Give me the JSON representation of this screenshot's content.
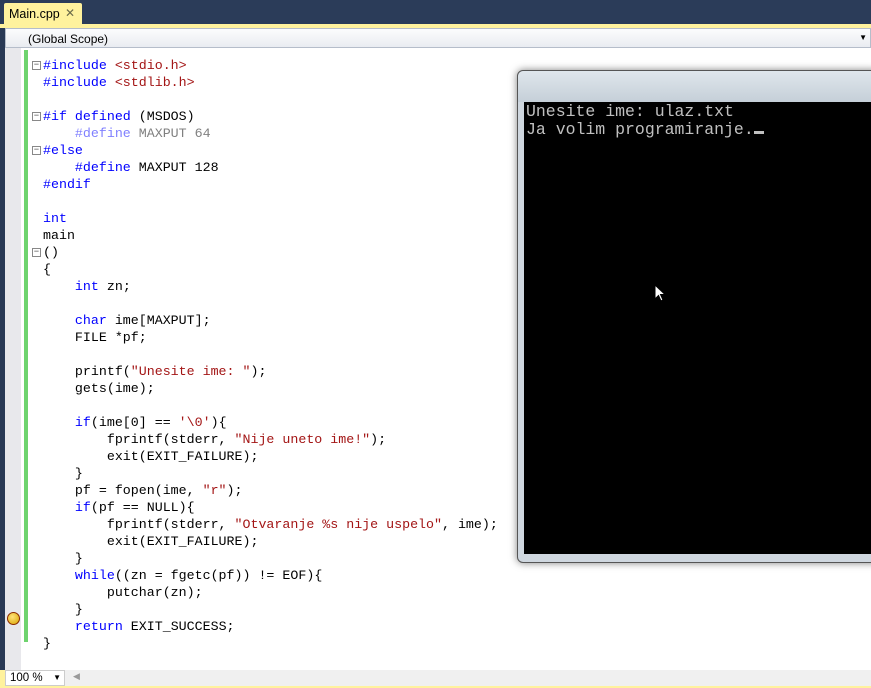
{
  "tab": {
    "title": "Main.cpp",
    "close": "✕"
  },
  "scope": {
    "value": "(Global Scope)"
  },
  "status": {
    "zoom": "100 %"
  },
  "console": {
    "lines": [
      "Unesite ime: ulaz.txt",
      "Ja volim programiranje."
    ]
  },
  "code": [
    [
      [
        "pp",
        "#include "
      ],
      [
        "str",
        "<stdio.h>"
      ]
    ],
    [
      [
        "pp",
        "#include "
      ],
      [
        "str",
        "<stdlib.h>"
      ]
    ],
    [],
    [
      [
        "pp",
        "#if defined "
      ],
      [
        "",
        "(MSDOS)"
      ]
    ],
    [
      [
        "",
        "    "
      ],
      [
        "dimkw",
        "#define "
      ],
      [
        "dim",
        "MAXPUT 64"
      ]
    ],
    [
      [
        "pp",
        "#else"
      ]
    ],
    [
      [
        "",
        "    "
      ],
      [
        "pp",
        "#define "
      ],
      [
        "",
        "MAXPUT 128"
      ]
    ],
    [
      [
        "pp",
        "#endif"
      ]
    ],
    [],
    [
      [
        "kw",
        "int"
      ]
    ],
    [
      [
        "",
        "main"
      ]
    ],
    [
      [
        "",
        "()"
      ]
    ],
    [
      [
        "",
        "{"
      ]
    ],
    [
      [
        "",
        "    "
      ],
      [
        "kw",
        "int"
      ],
      [
        "",
        " zn;"
      ]
    ],
    [],
    [
      [
        "",
        "    "
      ],
      [
        "kw",
        "char"
      ],
      [
        "",
        " ime[MAXPUT];"
      ]
    ],
    [
      [
        "",
        "    FILE *pf;"
      ]
    ],
    [],
    [
      [
        "",
        "    printf("
      ],
      [
        "str",
        "\"Unesite ime: \""
      ],
      [
        "",
        ");"
      ]
    ],
    [
      [
        "",
        "    gets(ime);"
      ]
    ],
    [],
    [
      [
        "",
        "    "
      ],
      [
        "kw",
        "if"
      ],
      [
        "",
        "(ime[0] == "
      ],
      [
        "str",
        "'\\0'"
      ],
      [
        "",
        "){"
      ]
    ],
    [
      [
        "",
        "        fprintf(stderr, "
      ],
      [
        "str",
        "\"Nije uneto ime!\""
      ],
      [
        "",
        ");"
      ]
    ],
    [
      [
        "",
        "        exit(EXIT_FAILURE);"
      ]
    ],
    [
      [
        "",
        "    }"
      ]
    ],
    [
      [
        "",
        "    pf = fopen(ime, "
      ],
      [
        "str",
        "\"r\""
      ],
      [
        "",
        ");"
      ]
    ],
    [
      [
        "",
        "    "
      ],
      [
        "kw",
        "if"
      ],
      [
        "",
        "(pf == NULL){"
      ]
    ],
    [
      [
        "",
        "        fprintf(stderr, "
      ],
      [
        "str",
        "\"Otvaranje %s nije uspelo\""
      ],
      [
        "",
        ", ime);"
      ]
    ],
    [
      [
        "",
        "        exit(EXIT_FAILURE);"
      ]
    ],
    [
      [
        "",
        "    }"
      ]
    ],
    [
      [
        "",
        "    "
      ],
      [
        "kw",
        "while"
      ],
      [
        "",
        "((zn = fgetc(pf)) != EOF){"
      ]
    ],
    [
      [
        "",
        "        putchar(zn);"
      ]
    ],
    [
      [
        "",
        "    }"
      ]
    ],
    [
      [
        "",
        "    "
      ],
      [
        "kw",
        "return"
      ],
      [
        "",
        " EXIT_SUCCESS;"
      ]
    ],
    [
      [
        "",
        "}"
      ]
    ]
  ]
}
